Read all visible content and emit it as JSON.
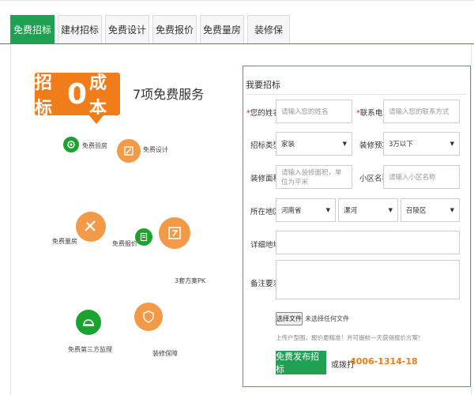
{
  "tabs": [
    {
      "label": "免费招标",
      "active": true
    },
    {
      "label": "建材招标",
      "active": false
    },
    {
      "label": "免费设计",
      "active": false
    },
    {
      "label": "免费报价",
      "active": false
    },
    {
      "label": "免费量房",
      "active": false
    },
    {
      "label": "装修保",
      "active": false
    }
  ],
  "promo": {
    "badge_pre": "招标",
    "badge_zero": "0",
    "badge_post": "成本",
    "subtitle": "7项免费服务",
    "services": [
      {
        "label": "免费验房",
        "icon": "eye-icon"
      },
      {
        "label": "免费设计",
        "icon": "pencil-icon"
      },
      {
        "label": "免费量房",
        "icon": "ruler-icon"
      },
      {
        "label": "免费报价",
        "icon": "document-icon"
      },
      {
        "label": "3套方案PK",
        "icon": "plan-icon"
      },
      {
        "label": "免费第三方监理",
        "icon": "helmet-icon"
      },
      {
        "label": "装修保障",
        "icon": "shield-icon"
      }
    ],
    "colors": {
      "orange": "#f07d1a",
      "green": "#1aa32f"
    }
  },
  "form": {
    "title": "我要招标",
    "name_label": "您的姓名",
    "name_placeholder": "请输入您的姓名",
    "phone_label": "联系电话",
    "phone_placeholder": "请输入您的联系方式",
    "type_label": "招标类型",
    "type_value": "家装",
    "budget_label": "装修预算",
    "budget_value": "3万以下",
    "area_label": "装修面积",
    "area_placeholder": "请输入装修面积，单位为平米",
    "community_label": "小区名称",
    "community_placeholder": "请输入小区名称",
    "region_label": "所在地区",
    "province_value": "河南省",
    "city_value": "漯河",
    "district_value": "召陵区",
    "address_label": "详细地址",
    "remark_label": "备注要求",
    "file_button": "选择文件",
    "file_status": "未选择任何文件",
    "hint": "上传户型图，报价更精准！并可提前一天获得报价方案！",
    "submit_label": "免费发布招标",
    "phone_prefix": "或拨打",
    "hotline": "4006-1314-18",
    "accent": "#20a052"
  }
}
